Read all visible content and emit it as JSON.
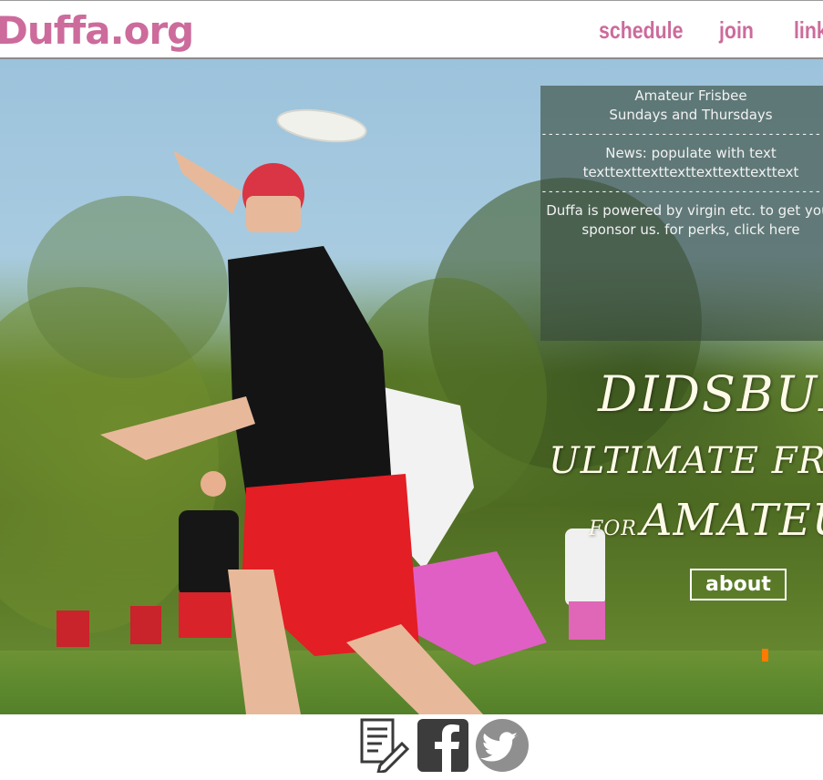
{
  "header": {
    "logo": "Duffa.org",
    "nav": [
      {
        "label": "schedule"
      },
      {
        "label": "join"
      },
      {
        "label": "links"
      }
    ]
  },
  "info": {
    "line1": "Amateur Frisbee",
    "line2": "Sundays and Thursdays",
    "divider": "------------------------------------------------",
    "news": "News: populate with text",
    "news_text": "texttexttexttexttexttexttexttext",
    "sponsor_line1": "Duffa is powered by virgin etc. to get your",
    "sponsor_line2": "sponsor us. for perks, click here"
  },
  "hero": {
    "title_line1": "DIDSBURY",
    "title_line2": "ULTIMATE FRISBEE",
    "title_for": "FOR",
    "title_line3": "AMATEURS",
    "about_label": "about"
  },
  "footer": {
    "icons": [
      "blog-icon",
      "facebook-icon",
      "twitter-icon"
    ]
  },
  "colors": {
    "brand": "#cc6b9c",
    "title_text": "#fffbe8",
    "overlay": "rgba(55,72,58,0.62)"
  }
}
